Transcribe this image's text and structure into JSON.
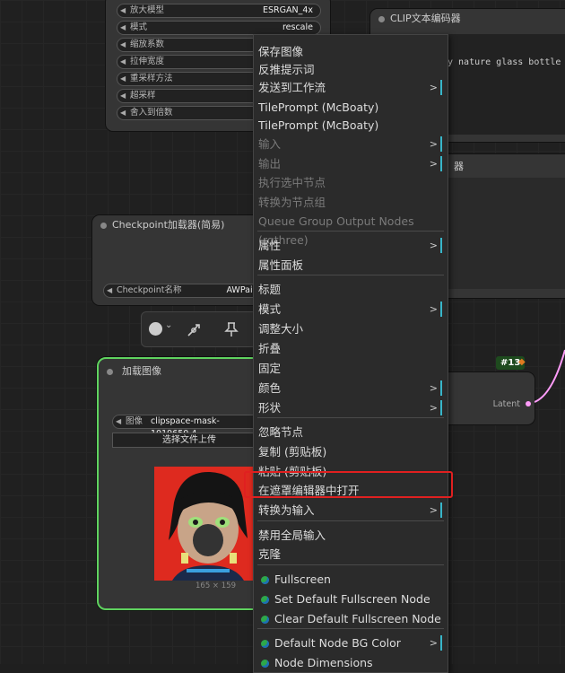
{
  "upscale_node": {
    "widgets": [
      {
        "label": "放大模型",
        "value": "ESRGAN_4x"
      },
      {
        "label": "模式",
        "value": "rescale"
      },
      {
        "label": "缩放系数",
        "value": ""
      },
      {
        "label": "拉伸宽度",
        "value": ""
      },
      {
        "label": "重采样方法",
        "value": ""
      },
      {
        "label": "超采样",
        "value": ""
      },
      {
        "label": "舍入到倍数",
        "value": ""
      }
    ]
  },
  "clip_node": {
    "title": "CLIP文本编码器",
    "text": "y nature glass bottle lands"
  },
  "clip_node2": {
    "title_fragment": "器"
  },
  "checkpoint_node": {
    "title": "Checkpoint加载器(简易)",
    "widget_label": "Checkpoint名称",
    "widget_value": "AWPaintin"
  },
  "load_image_node": {
    "title": "加载图像",
    "widget_label": "图像",
    "widget_value": "clipspace-mask-1019650.4",
    "upload_label": "选择文件上传",
    "image_size": "165 × 159"
  },
  "latent_node": {
    "badge": "#13",
    "output_label": "Latent"
  },
  "colors": {
    "accent": "#38b6c9",
    "highlight": "#e02020",
    "selected_border": "#5fd35f"
  },
  "menu": {
    "items": [
      {
        "label": "保存图像",
        "disabled": false,
        "submenu": false
      },
      {
        "label": "反推提示词",
        "disabled": false,
        "submenu": false
      },
      {
        "label": "发送到工作流",
        "disabled": false,
        "submenu": true
      },
      {
        "label": "TilePrompt (McBoaty)",
        "disabled": false,
        "submenu": false
      },
      {
        "label": "TilePrompt (McBoaty)",
        "disabled": false,
        "submenu": false
      },
      {
        "label": "输入",
        "disabled": true,
        "submenu": true
      },
      {
        "label": "输出",
        "disabled": true,
        "submenu": true
      },
      {
        "label": "执行选中节点",
        "disabled": true,
        "submenu": false
      },
      {
        "label": "转换为节点组",
        "disabled": true,
        "submenu": false
      },
      {
        "label": "Queue Group Output Nodes (rgthree)",
        "disabled": true,
        "submenu": false
      },
      {
        "label": "属性",
        "disabled": false,
        "submenu": true
      },
      {
        "label": "属性面板",
        "disabled": false,
        "submenu": false
      },
      {
        "label": "标题",
        "disabled": false,
        "submenu": false
      },
      {
        "label": "模式",
        "disabled": false,
        "submenu": true
      },
      {
        "label": "调整大小",
        "disabled": false,
        "submenu": false
      },
      {
        "label": "折叠",
        "disabled": false,
        "submenu": false
      },
      {
        "label": "固定",
        "disabled": false,
        "submenu": false
      },
      {
        "label": "颜色",
        "disabled": false,
        "submenu": true
      },
      {
        "label": "形状",
        "disabled": false,
        "submenu": true
      },
      {
        "label": "忽略节点",
        "disabled": false,
        "submenu": false
      },
      {
        "label": "复制 (剪贴板)",
        "disabled": false,
        "submenu": false
      },
      {
        "label": "粘贴 (剪贴板)",
        "disabled": false,
        "submenu": false
      },
      {
        "label": "在遮罩编辑器中打开",
        "disabled": false,
        "submenu": false
      },
      {
        "label": "转换为输入",
        "disabled": false,
        "submenu": true
      },
      {
        "label": "禁用全局输入",
        "disabled": false,
        "submenu": false
      },
      {
        "label": "克隆",
        "disabled": false,
        "submenu": false
      },
      {
        "label": "Fullscreen",
        "disabled": false,
        "submenu": false,
        "icon": true
      },
      {
        "label": "Set Default Fullscreen Node",
        "disabled": false,
        "submenu": false,
        "icon": true
      },
      {
        "label": "Clear Default Fullscreen Node",
        "disabled": false,
        "submenu": false,
        "icon": true
      },
      {
        "label": "Default Node BG Color",
        "disabled": false,
        "submenu": true,
        "icon": true
      },
      {
        "label": "Node Dimensions",
        "disabled": false,
        "submenu": false,
        "icon": true
      }
    ]
  }
}
